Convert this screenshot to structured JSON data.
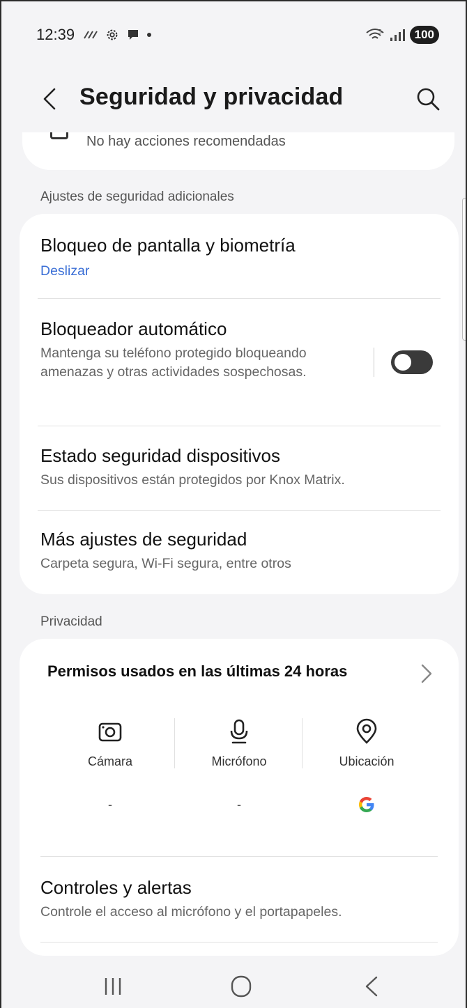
{
  "status_bar": {
    "time": "12:39",
    "battery": "100"
  },
  "header": {
    "title": "Seguridad y privacidad"
  },
  "top_card": {
    "text": "No hay acciones recomendadas"
  },
  "security_section": {
    "label": "Ajustes de seguridad adicionales",
    "items": [
      {
        "title": "Bloqueo de pantalla y biometría",
        "subtitle": "Deslizar"
      },
      {
        "title": "Bloqueador automático",
        "subtitle": "Mantenga su teléfono protegido bloqueando amenazas y otras actividades sospechosas.",
        "toggle_on": false
      },
      {
        "title": "Estado seguridad dispositivos",
        "subtitle": "Sus dispositivos están protegidos por Knox Matrix."
      },
      {
        "title": "Más ajustes de seguridad",
        "subtitle": "Carpeta segura, Wi-Fi segura, entre otros"
      }
    ]
  },
  "privacy_section": {
    "label": "Privacidad",
    "permissions": {
      "title": "Permisos usados en las últimas 24 horas",
      "columns": [
        {
          "label": "Cámara",
          "icon": "camera-icon",
          "value": "-"
        },
        {
          "label": "Micrófono",
          "icon": "microphone-icon",
          "value": "-"
        },
        {
          "label": "Ubicación",
          "icon": "location-icon",
          "value_icon": "google-icon"
        }
      ]
    },
    "controls": {
      "title": "Controles y alertas",
      "subtitle": "Controle el acceso al micrófono y el portapapeles."
    }
  },
  "colors": {
    "accent_blue": "#3b6fd6",
    "background": "#f4f4f6",
    "card": "#ffffff"
  }
}
